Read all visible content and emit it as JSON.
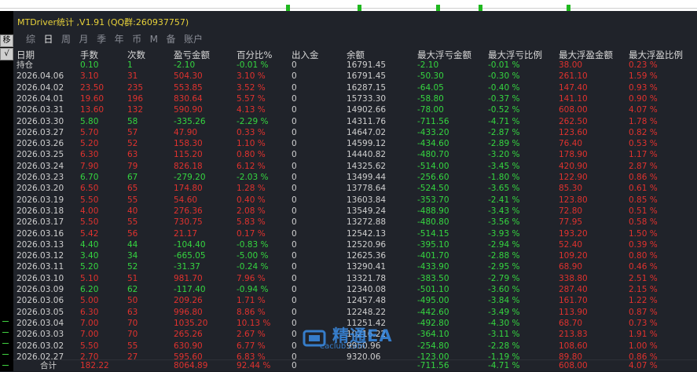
{
  "window": {
    "title": "MTDriver统计 ,V1.91 (QQ群:260937757)"
  },
  "left_toolbar": {
    "move_button": "移",
    "check_button": "√"
  },
  "tabs": [
    {
      "label": "综",
      "active": false
    },
    {
      "label": "日",
      "active": true
    },
    {
      "label": "周",
      "active": false
    },
    {
      "label": "月",
      "active": false
    },
    {
      "label": "季",
      "active": false
    },
    {
      "label": "年",
      "active": false
    },
    {
      "label": "币",
      "active": false
    },
    {
      "label": "M",
      "active": false
    },
    {
      "label": "备",
      "active": false
    },
    {
      "label": "账户",
      "active": false
    }
  ],
  "table": {
    "headers": [
      "日期",
      "手数",
      "次数",
      "盈亏金额",
      "百分比%",
      "出入金",
      "余额",
      "最大浮亏金额",
      "最大浮亏比例",
      "最大浮盈金额",
      "最大浮盈比例"
    ],
    "rows": [
      {
        "c": [
          "持仓",
          "0.10",
          "1",
          "-2.10",
          "-0.01 %",
          "0",
          "16791.45",
          "-2.10",
          "-0.01 %",
          "38.00",
          "0.23 %"
        ],
        "tone": "green"
      },
      {
        "c": [
          "2026.04.06",
          "3.10",
          "31",
          "504.30",
          "3.10 %",
          "0",
          "16791.45",
          "-50.30",
          "-0.30 %",
          "261.10",
          "1.59 %"
        ],
        "tone": "red"
      },
      {
        "c": [
          "2026.04.02",
          "23.50",
          "235",
          "553.85",
          "3.52 %",
          "0",
          "16287.15",
          "-64.05",
          "-0.40 %",
          "147.40",
          "0.93 %"
        ],
        "tone": "red"
      },
      {
        "c": [
          "2026.04.01",
          "19.60",
          "196",
          "830.64",
          "5.57 %",
          "0",
          "15733.30",
          "-58.80",
          "-0.37 %",
          "141.10",
          "0.90 %"
        ],
        "tone": "red"
      },
      {
        "c": [
          "2026.03.31",
          "13.60",
          "132",
          "590.90",
          "4.13 %",
          "0",
          "14902.66",
          "-78.00",
          "-0.52 %",
          "608.00",
          "4.07 %"
        ],
        "tone": "red"
      },
      {
        "c": [
          "2026.03.30",
          "5.80",
          "58",
          "-335.26",
          "-2.29 %",
          "0",
          "14311.76",
          "-711.56",
          "-4.71 %",
          "262.50",
          "1.78 %"
        ],
        "tone": "green"
      },
      {
        "c": [
          "2026.03.27",
          "5.70",
          "57",
          "47.90",
          "0.33 %",
          "0",
          "14647.02",
          "-433.20",
          "-2.87 %",
          "123.60",
          "0.82 %"
        ],
        "tone": "red"
      },
      {
        "c": [
          "2026.03.26",
          "5.20",
          "52",
          "158.30",
          "1.10 %",
          "0",
          "14599.12",
          "-434.60",
          "-2.89 %",
          "76.40",
          "0.53 %"
        ],
        "tone": "red"
      },
      {
        "c": [
          "2026.03.25",
          "6.30",
          "63",
          "115.20",
          "0.80 %",
          "0",
          "14440.82",
          "-480.70",
          "-3.20 %",
          "178.90",
          "1.17 %"
        ],
        "tone": "red"
      },
      {
        "c": [
          "2026.03.24",
          "7.90",
          "79",
          "826.18",
          "6.12 %",
          "0",
          "14325.62",
          "-514.00",
          "-3.45 %",
          "420.90",
          "2.87 %"
        ],
        "tone": "red"
      },
      {
        "c": [
          "2026.03.23",
          "6.70",
          "67",
          "-279.20",
          "-2.03 %",
          "0",
          "13499.44",
          "-256.60",
          "-1.80 %",
          "122.90",
          "0.86 %"
        ],
        "tone": "green"
      },
      {
        "c": [
          "2026.03.20",
          "6.50",
          "65",
          "174.80",
          "1.28 %",
          "0",
          "13778.64",
          "-524.50",
          "-3.65 %",
          "85.30",
          "0.61 %"
        ],
        "tone": "red"
      },
      {
        "c": [
          "2026.03.19",
          "5.50",
          "55",
          "54.60",
          "0.40 %",
          "0",
          "13603.84",
          "-353.70",
          "-2.41 %",
          "123.80",
          "0.85 %"
        ],
        "tone": "red"
      },
      {
        "c": [
          "2026.03.18",
          "4.00",
          "40",
          "276.36",
          "2.08 %",
          "0",
          "13549.24",
          "-488.90",
          "-3.43 %",
          "72.80",
          "0.51 %"
        ],
        "tone": "red"
      },
      {
        "c": [
          "2026.03.17",
          "5.50",
          "55",
          "730.75",
          "5.83 %",
          "0",
          "13272.88",
          "-480.80",
          "-3.56 %",
          "77.95",
          "0.58 %"
        ],
        "tone": "red"
      },
      {
        "c": [
          "2026.03.16",
          "5.42",
          "56",
          "21.17",
          "0.17 %",
          "0",
          "12542.13",
          "-514.15",
          "-3.93 %",
          "193.20",
          "1.50 %"
        ],
        "tone": "red"
      },
      {
        "c": [
          "2026.03.13",
          "4.40",
          "44",
          "-104.40",
          "-0.83 %",
          "0",
          "12520.96",
          "-395.10",
          "-2.94 %",
          "52.40",
          "0.39 %"
        ],
        "tone": "green"
      },
      {
        "c": [
          "2026.03.12",
          "3.40",
          "34",
          "-665.05",
          "-5.00 %",
          "0",
          "12625.36",
          "-401.70",
          "-2.88 %",
          "109.20",
          "0.80 %"
        ],
        "tone": "green"
      },
      {
        "c": [
          "2026.03.11",
          "5.20",
          "52",
          "-31.37",
          "-0.24 %",
          "0",
          "13290.41",
          "-433.90",
          "-2.95 %",
          "68.90",
          "0.46 %"
        ],
        "tone": "green"
      },
      {
        "c": [
          "2026.03.10",
          "5.10",
          "51",
          "981.70",
          "7.96 %",
          "0",
          "13321.78",
          "-383.50",
          "-2.79 %",
          "338.80",
          "2.51 %"
        ],
        "tone": "red"
      },
      {
        "c": [
          "2026.03.09",
          "6.20",
          "62",
          "-117.40",
          "-0.94 %",
          "0",
          "12340.08",
          "-501.10",
          "-3.60 %",
          "287.40",
          "2.15 %"
        ],
        "tone": "green"
      },
      {
        "c": [
          "2026.03.06",
          "5.00",
          "50",
          "209.26",
          "1.71 %",
          "0",
          "12457.48",
          "-495.00",
          "-3.84 %",
          "161.70",
          "1.22 %"
        ],
        "tone": "red"
      },
      {
        "c": [
          "2026.03.05",
          "6.30",
          "63",
          "996.80",
          "8.86 %",
          "0",
          "12248.22",
          "-442.60",
          "-3.49 %",
          "113.90",
          "0.87 %"
        ],
        "tone": "red"
      },
      {
        "c": [
          "2026.03.04",
          "7.00",
          "70",
          "1035.20",
          "10.13 %",
          "0",
          "11251.42",
          "-492.80",
          "-4.30 %",
          "68.70",
          "0.73 %"
        ],
        "tone": "red"
      },
      {
        "c": [
          "2026.03.03",
          "7.00",
          "70",
          "265.26",
          "2.67 %",
          "0",
          "10216.22",
          "-364.10",
          "-3.11 %",
          "213.83",
          "1.91 %"
        ],
        "tone": "red"
      },
      {
        "c": [
          "2026.03.02",
          "5.50",
          "55",
          "630.90",
          "6.77 %",
          "0",
          "9950.96",
          "-254.80",
          "-2.28 %",
          "108.60",
          "1.00 %"
        ],
        "tone": "red"
      },
      {
        "c": [
          "2026.02.27",
          "2.70",
          "27",
          "595.60",
          "6.83 %",
          "0",
          "9320.06",
          "-123.00",
          "-1.19 %",
          "89.80",
          "0.86 %"
        ],
        "tone": "red"
      }
    ],
    "total": {
      "c": [
        "合计",
        "182.22",
        "",
        "8064.89",
        "92.44 %",
        "0",
        "",
        "-711.56",
        "-4.71 %",
        "608.00",
        "4.07 %"
      ]
    }
  },
  "watermark": {
    "title": "精通EA",
    "url": "eaclub.com"
  },
  "colors": {
    "profit": "#e0322e",
    "loss": "#35d640",
    "title": "#e8d23a",
    "background": "#20232a"
  }
}
